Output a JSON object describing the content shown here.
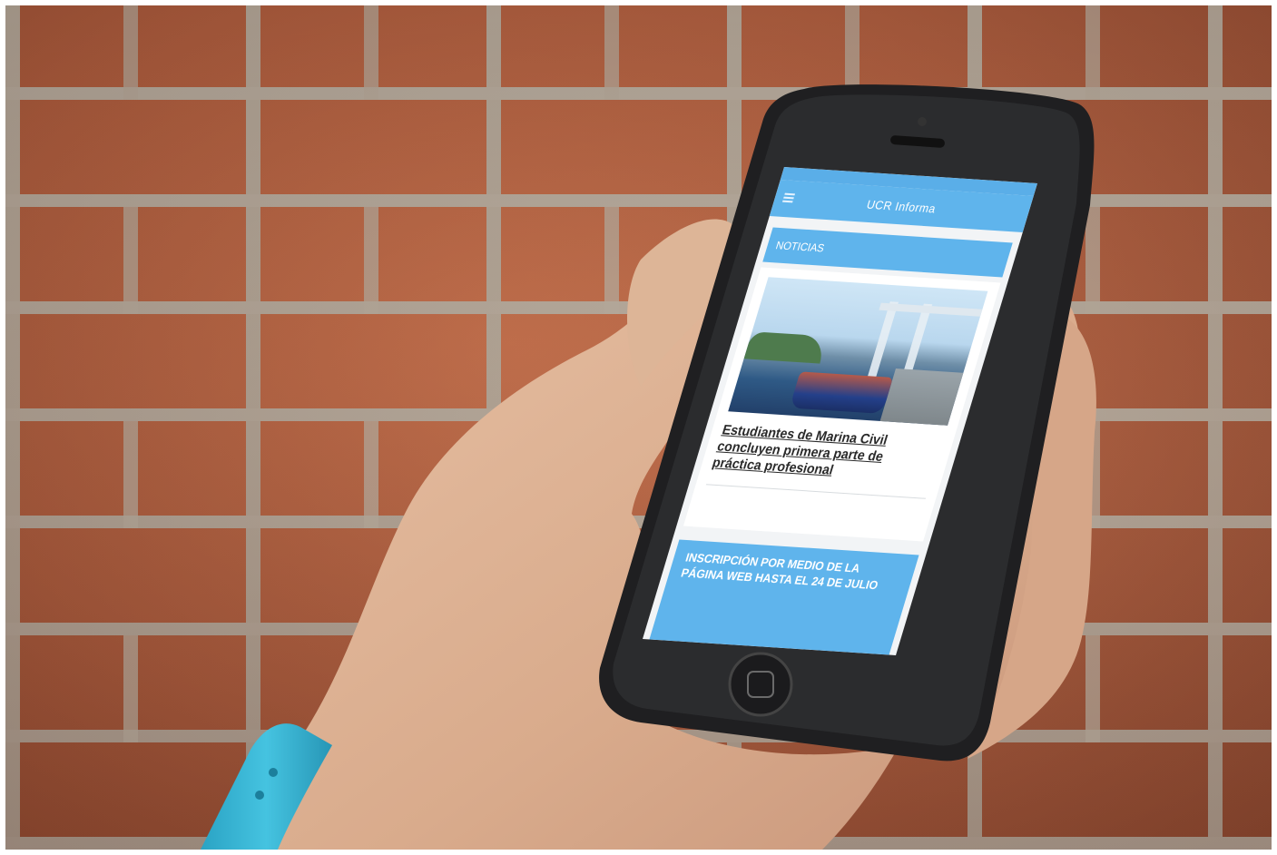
{
  "status_bar": {
    "left": "",
    "time": "",
    "right": ""
  },
  "app_bar": {
    "title": "UCR Informa"
  },
  "section": {
    "header": "NOTICIAS"
  },
  "news": {
    "title": "Estudiantes de Marina Civil concluyen primera parte de práctica profesional",
    "more_link": ""
  },
  "banner": {
    "text": "INSCRIPCIÓN POR MEDIO DE LA PÁGINA WEB HASTA EL 24 DE JULIO"
  },
  "colors": {
    "app_blue": "#5fb4ec",
    "screen_background": "#f2f4f6",
    "wristband": "#3bb8d6",
    "brick": "#b0603f",
    "mortar": "#b7b1a4"
  },
  "icons": [
    "menu-icon",
    "home-button-icon",
    "camera-icon",
    "speaker-icon"
  ]
}
